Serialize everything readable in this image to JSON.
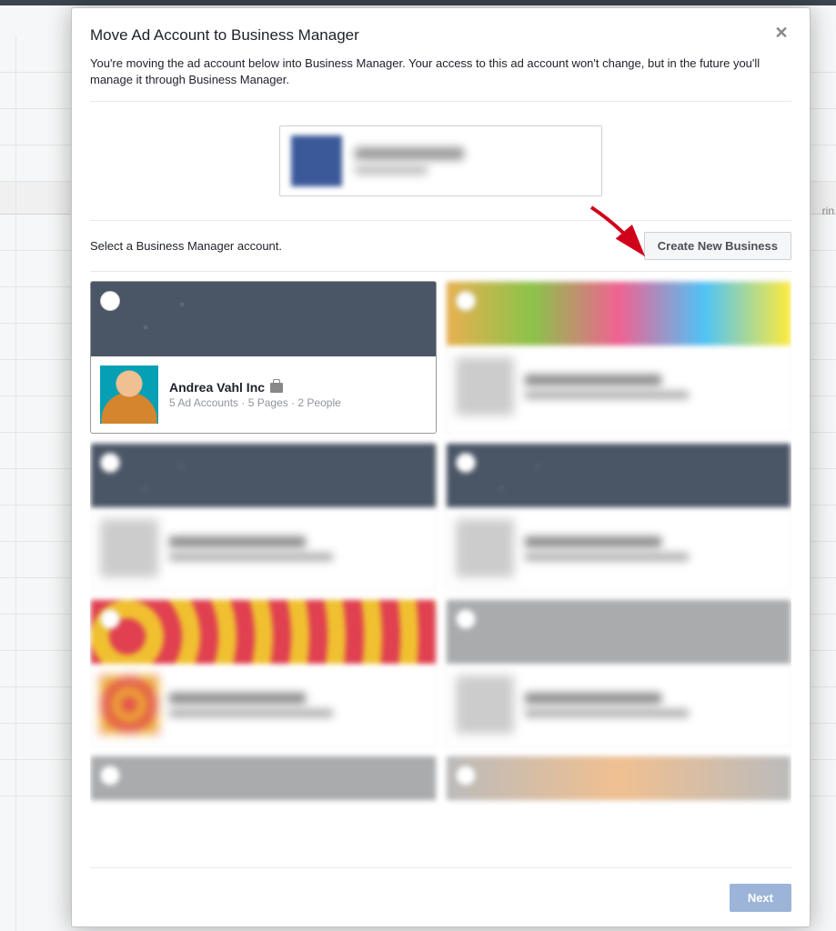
{
  "modal": {
    "title": "Move Ad Account to Business Manager",
    "description": "You're moving the ad account below into Business Manager. Your access to this ad account won't change, but in the future you'll manage it through Business Manager.",
    "select_label": "Select a Business Manager account.",
    "create_button": "Create New Business",
    "next_button": "Next"
  },
  "accounts": [
    {
      "name": "Andrea Vahl Inc",
      "stats": "5 Ad Accounts · 5 Pages · 2 People",
      "selected": true
    }
  ],
  "bg_fragment": "rin"
}
